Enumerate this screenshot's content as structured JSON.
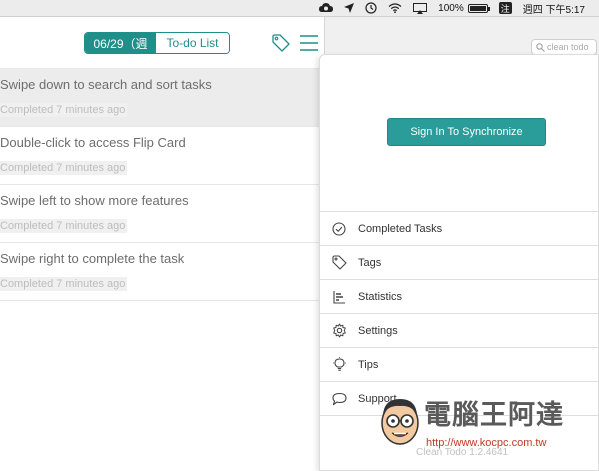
{
  "menubar": {
    "battery": "100%",
    "battery_level": 1.0,
    "ime": "注",
    "clock": "週四 下午5:17",
    "icons": [
      "creative-cloud-icon",
      "location-arrow-icon",
      "time-machine-icon",
      "wifi-icon",
      "airplay-icon",
      "battery-icon",
      "ime-icon"
    ]
  },
  "background_window": {
    "search_placeholder": "clean todo"
  },
  "header": {
    "date_segment": "06/29（週",
    "list_segment": "To-do List",
    "icons": [
      "tag-icon",
      "hamburger-menu-icon"
    ]
  },
  "tasks": [
    {
      "title": "Swipe down to search and sort tasks",
      "meta": "Completed 7 minutes ago"
    },
    {
      "title": "Double-click to access Flip Card",
      "meta": "Completed 7 minutes ago"
    },
    {
      "title": "Swipe left to show more features",
      "meta": "Completed 7 minutes ago"
    },
    {
      "title": "Swipe right to complete the task",
      "meta": "Completed 7 minutes ago"
    }
  ],
  "panel": {
    "sync_button": "Sign In To Synchronize",
    "menu": [
      {
        "label": "Completed Tasks",
        "icon": "check-circle-icon"
      },
      {
        "label": "Tags",
        "icon": "tag-icon"
      },
      {
        "label": "Statistics",
        "icon": "statistics-icon"
      },
      {
        "label": "Settings",
        "icon": "gear-icon"
      },
      {
        "label": "Tips",
        "icon": "lightbulb-icon"
      },
      {
        "label": "Support",
        "icon": "speech-bubble-icon"
      }
    ],
    "version": "Clean Todo 1.2.4641"
  },
  "watermark": {
    "title": "電腦王阿達",
    "url": "http://www.kocpc.com.tw"
  },
  "colors": {
    "accent": "#1f8f8a",
    "button": "#2a9c9a"
  }
}
